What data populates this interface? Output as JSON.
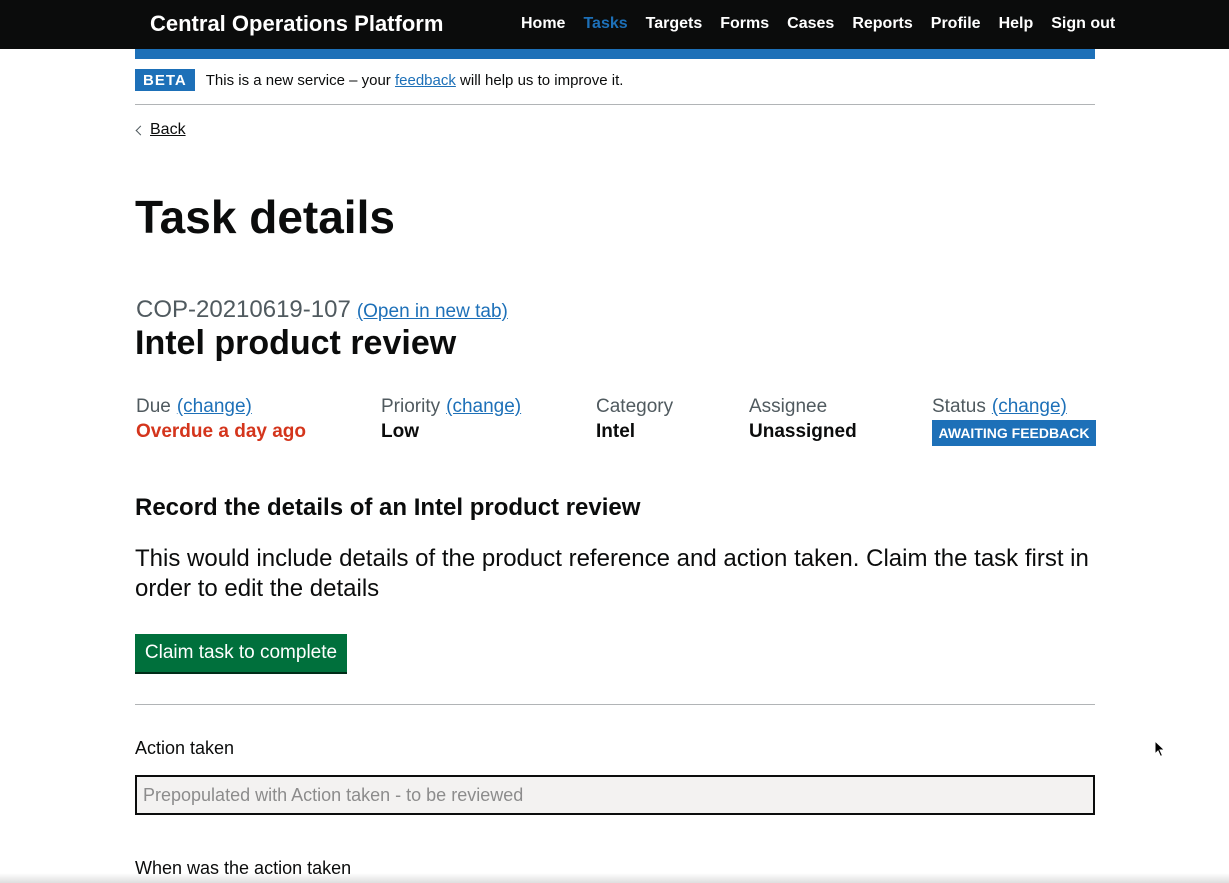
{
  "header": {
    "service_name": "Central Operations Platform",
    "nav": [
      {
        "label": "Home",
        "active": false
      },
      {
        "label": "Tasks",
        "active": true
      },
      {
        "label": "Targets",
        "active": false
      },
      {
        "label": "Forms",
        "active": false
      },
      {
        "label": "Cases",
        "active": false
      },
      {
        "label": "Reports",
        "active": false
      },
      {
        "label": "Profile",
        "active": false
      },
      {
        "label": "Help",
        "active": false
      },
      {
        "label": "Sign out",
        "active": false
      }
    ]
  },
  "phase_banner": {
    "tag": "BETA",
    "text_before": "This is a new service – your ",
    "link": "feedback",
    "text_after": " will help us to improve it."
  },
  "back_link": "Back",
  "page_title": "Task details",
  "task": {
    "reference": "COP-20210619-107",
    "open_new_tab": "(Open in new tab)",
    "name": "Intel product review"
  },
  "summary": {
    "change_label": "(change)",
    "due": {
      "label": "Due",
      "value": "Overdue a day ago"
    },
    "priority": {
      "label": "Priority",
      "value": "Low"
    },
    "category": {
      "label": "Category",
      "value": "Intel"
    },
    "assignee": {
      "label": "Assignee",
      "value": "Unassigned"
    },
    "status": {
      "label": "Status",
      "value": "AWAITING FEEDBACK"
    }
  },
  "section": {
    "heading": "Record the details of an Intel product review",
    "body": "This would include details of the product reference and action taken. Claim the task first in order to edit the details"
  },
  "claim_button": "Claim task to complete",
  "form": {
    "action_taken_label": "Action taken",
    "action_taken_placeholder": "Prepopulated with Action taken - to be reviewed",
    "action_taken_value": "",
    "when_label": "When was the action taken"
  },
  "colors": {
    "header_bg": "#0b0c0c",
    "link_blue": "#1d70b8",
    "overdue_red": "#d4351c",
    "button_green": "#00703c"
  }
}
